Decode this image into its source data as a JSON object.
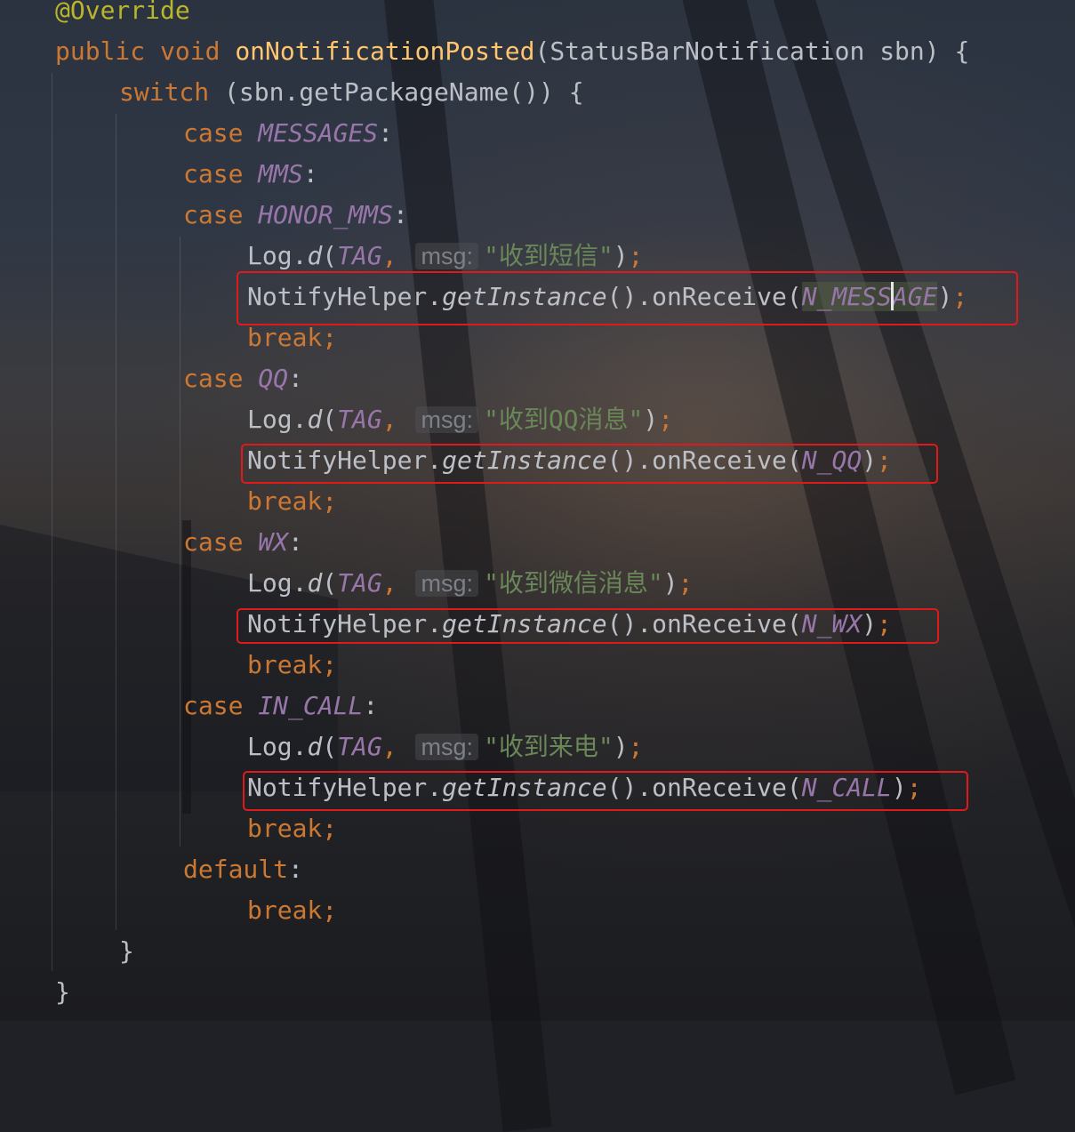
{
  "code": {
    "annotation": "@Override",
    "method_decl": {
      "kw_public": "public",
      "kw_void": "void",
      "name": "onNotificationPosted",
      "params": "(StatusBarNotification sbn) {"
    },
    "switch_line": {
      "kw": "switch",
      "expr": " (sbn.getPackageName()) {"
    },
    "kw_case": "case",
    "kw_break": "break",
    "kw_default": "default",
    "colon": ":",
    "semicolon": ";",
    "log": {
      "prefix": "Log.",
      "method": "d",
      "open": "(",
      "tag": "TAG",
      "comma": ",",
      "hint": "msg:",
      "close": ")"
    },
    "notify": {
      "prefix": "NotifyHelper.",
      "method": "getInstance",
      "middle": "().onReceive(",
      "close": ")"
    },
    "cases": [
      {
        "constants": [
          "MESSAGES",
          "MMS",
          "HONOR_MMS"
        ],
        "log_msg": "\"收到短信\"",
        "notify_arg_a": "N_MESS",
        "notify_arg_b": "AGE"
      },
      {
        "constants": [
          "QQ"
        ],
        "log_msg": "\"收到QQ消息\"",
        "notify_arg": "N_QQ"
      },
      {
        "constants": [
          "WX"
        ],
        "log_msg": "\"收到微信消息\"",
        "notify_arg": "N_WX"
      },
      {
        "constants": [
          "IN_CALL"
        ],
        "log_msg": "\"收到来电\"",
        "notify_arg": "N_CALL"
      }
    ],
    "close_brace": "}"
  },
  "colors": {
    "keyword": "#cc7832",
    "annotation": "#bbb529",
    "function": "#ffc66d",
    "constant": "#9876aa",
    "string": "#6a8759",
    "text": "#bcc0c6",
    "highlight_box": "#e01a1a"
  }
}
